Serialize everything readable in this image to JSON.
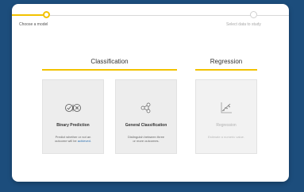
{
  "steps": [
    {
      "label": "Choose a model",
      "active": true
    },
    {
      "label": "Select data to study",
      "active": false
    }
  ],
  "sections": {
    "classification": {
      "title": "Classification"
    },
    "regression": {
      "title": "Regression"
    }
  },
  "options": {
    "binary": {
      "title": "Binary Prediction",
      "desc_lead": "Predict whether or not an",
      "desc_mid": "outcome will be",
      "desc_accent": "achieved.",
      "icon": "check-x-circles-icon"
    },
    "general": {
      "title": "General Classification",
      "desc_lead": "Distinguish between three",
      "desc_tail": "or more outcomes.",
      "icon": "network-nodes-icon"
    },
    "regression": {
      "title": "Regression",
      "desc": "Estimate a numeric value.",
      "icon": "scatter-trend-icon"
    }
  },
  "colors": {
    "background": "#1c4d7c",
    "accent": "#f2c200",
    "link": "#2a6fb0"
  }
}
